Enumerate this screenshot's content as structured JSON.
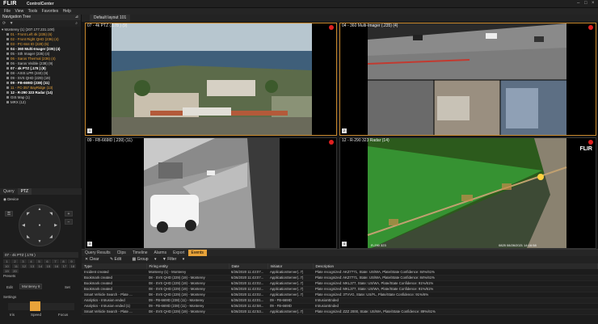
{
  "app": {
    "logo": "FLIR",
    "name": "ControlCenter"
  },
  "menu": [
    "File",
    "View",
    "Tools",
    "Favorites",
    "Help"
  ],
  "nav_tree": {
    "title": "Navigation Tree",
    "root": "Monterey (1) (207.177.231.100)",
    "items": [
      {
        "label": "01 - Front Left 4k (235) (6)",
        "style": "orange"
      },
      {
        "label": "02 - Front Right QHD (236) (4)",
        "style": "orange"
      },
      {
        "label": "03 - PC-844 ID (228) (5)",
        "style": "orange"
      },
      {
        "label": "04 - 360 Multi-Imager (235) (4)",
        "style": "bold"
      },
      {
        "label": "05 - Sth Imager (235) (4)",
        "style": "normal"
      },
      {
        "label": "06 - Saros Thermal (236) (4)",
        "style": "orange"
      },
      {
        "label": "06 - Saros Visible (238) (9)",
        "style": "normal"
      },
      {
        "label": "07 - 4k PTZ (.178 ) (9)",
        "style": "bold"
      },
      {
        "label": "08 - AXIS LPR (240) (9)",
        "style": "normal"
      },
      {
        "label": "09 - SVS QHD (229) (19)",
        "style": "normal"
      },
      {
        "label": "09 - FB-669ID (238) (11)",
        "style": "bold"
      },
      {
        "label": "11 - FC-357 BayRidge (13)",
        "style": "orange"
      },
      {
        "label": "12 - R-290 323 Radar (14)",
        "style": "bold"
      },
      {
        "label": "GIS Map (1)",
        "style": "normal"
      },
      {
        "label": "MRX (12)",
        "style": "normal"
      }
    ]
  },
  "ptz_panel": {
    "tabs": [
      "Query",
      "PTZ"
    ],
    "mode": "Device",
    "camera": "07 - 4k PTZ (.178 )",
    "presets_label": "Presets",
    "edit_label": "Edit",
    "preset_value": "Monterey 8",
    "set_label": "Set",
    "settings_label": "Settings",
    "iris_label": "Iris",
    "speed_label": "Speed",
    "focus_label": "Focus"
  },
  "layout_tab": "Default layout 101",
  "cameras": [
    {
      "title": "07 - 4k PTZ (.178 ) (9)",
      "num": "1",
      "selected": true
    },
    {
      "title": "04 - 360 Multi-Imager (.235) (4)",
      "num": "2",
      "selected": true
    },
    {
      "title": "09 - FB-669ID (.239) (11)",
      "num": "3",
      "selected": false
    },
    {
      "title": "12 - R-290 323 Radar (14)",
      "num": "4",
      "selected": false,
      "overlay_logo": "FLIR",
      "footer": "R-290 323",
      "timestamp": "0825 08/26/2021 14:16:58"
    }
  ],
  "results": {
    "tabs": [
      "Query Results",
      "Clips",
      "Timeline",
      "Alarms",
      "Export",
      "Events"
    ],
    "tools": [
      "Clear",
      "Edit",
      "Group",
      "Filter"
    ],
    "columns": [
      "Type",
      "Firing entity",
      "Date",
      "Initiator",
      "Description"
    ],
    "rows": [
      [
        "Incident created",
        "Monterey (1) - Monterey",
        "6/26/2020 11:43:07...",
        "ApplicationServer(..7)",
        "Plate recognized: AKZ7771, State: US/WA, Plate/State Confidence: 84%/61%"
      ],
      [
        "Bookmark created",
        "08 - SVS QHD (229) (19) - Monterey",
        "6/26/2020 11:43:07...",
        "ApplicationServer(..7)",
        "Plate recognized: AKZ7771, State: US/WA, Plate/State Confidence: 84%/61%"
      ],
      [
        "Bookmark created",
        "08 - SVS QHD (229) (19) - Monterey",
        "6/26/2020 11:43:02...",
        "ApplicationServer(..7)",
        "Plate recognized: MKL377, State: US/WA, Plate/State Confidence: 91%/61%"
      ],
      [
        "Bookmark created",
        "08 - SVS QHD (229) (19) - Monterey",
        "6/26/2020 11:43:02...",
        "ApplicationServer(..7)",
        "Plate recognized: MKL377, State: US/WA, Plate/State Confidence: 91%/61%"
      ],
      [
        "Smart Vehicle Search - Plate ...",
        "08 - SVS QHD (229) (19) - Monterey",
        "6/26/2020 11:43:02...",
        "ApplicationServer(..7)",
        "Plate recognized: 3TVVG, State: US/FL, Plate/State Confidence: 91%/6%"
      ],
      [
        "Analytics - Intrusion ended",
        "09 - FB-669ID (238) (11) - Monterey",
        "6/26/2020 11:43:01...",
        "09 - FB-669ID",
        "IntrusionEnded"
      ],
      [
        "Analytics - Intrusion ended (1)",
        "09 - FB-669ID (238) (11) - Monterey",
        "6/26/2020 11:42:58...",
        "09 - FB-669ID",
        "IntrusionEnded"
      ],
      [
        "Smart Vehicle Search - Plate ...",
        "08 - SVS QHD (229) (19) - Monterey",
        "6/26/2020 11:42:53...",
        "ApplicationServer(..7)",
        "Plate recognized: ZZZ 2000, State: US/WA, Plate/State Confidence: 89%/61%"
      ]
    ]
  }
}
